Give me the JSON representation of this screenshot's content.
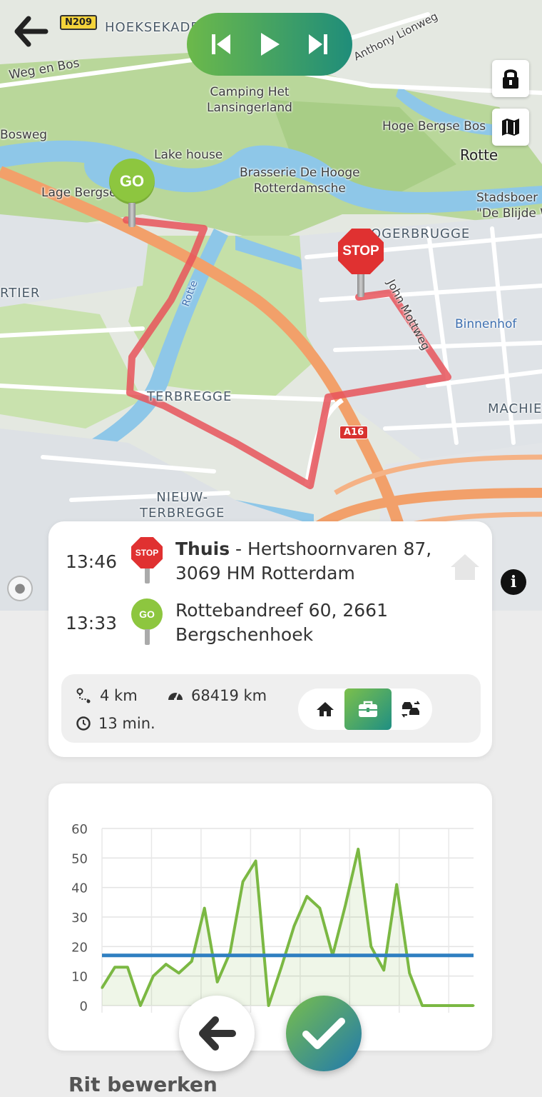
{
  "nav": {
    "back_icon": "arrow-left-icon",
    "player": {
      "prev_icon": "skip-previous-icon",
      "play_icon": "play-icon",
      "next_icon": "skip-next-icon"
    },
    "side_buttons": [
      "lock-icon",
      "map-icon"
    ],
    "info_icon": "info-icon"
  },
  "map": {
    "labels": {
      "hoeksekade": "HOEKSEKADE",
      "weg_en_bos": "Weg en Bos",
      "anthony": "Anthony Lionweg",
      "camping": "Camping Het\nLansingerland",
      "bosweg": "Bosweg",
      "lake_house": "Lake house",
      "hoge_bergse_bos": "Hoge Bergse Bos",
      "rotte": "Rotte",
      "brasserie": "Brasserie De Hooge\nRotterdamsche",
      "lage_bergse": "Lage Bergse",
      "stadsboerderij": "Stadsboer\n\"De Blijde W",
      "ogerbrugge": "OGERBRUGGE",
      "rtier": "RTIER",
      "rotte_river": "Rotte",
      "john_mottweg": "John Mottweg",
      "binnenhof": "Binnenhof",
      "terbregge": "TERBREGGE",
      "machie": "MACHIE",
      "nieuw_terbregge": "NIEUW-\nTERBREGGE"
    },
    "road_shields": {
      "n209": "N209",
      "a16": "A16"
    },
    "pins": {
      "go": "GO",
      "stop": "STOP"
    }
  },
  "trip": {
    "stops": [
      {
        "time": "13:46",
        "pin": "STOP",
        "name": "Thuis",
        "address_line1": " - Hertshoornvaren 87,",
        "address_line2": "3069 HM Rotterdam",
        "home_icon": "home-icon"
      },
      {
        "time": "13:33",
        "pin": "GO",
        "address_line1": "Rottebandreef 60, 2661",
        "address_line2": "Bergschenhoek"
      }
    ],
    "distance": "4 km",
    "odometer": "68419 km",
    "duration": "13 min.",
    "categories": [
      {
        "icon": "home-icon",
        "active": false
      },
      {
        "icon": "briefcase-icon",
        "active": true
      },
      {
        "icon": "car-swap-icon",
        "active": false
      }
    ],
    "colors": {
      "accent_green": "#8dc63f",
      "stop_red": "#e03131",
      "route": "#e8545a"
    }
  },
  "chart_data": {
    "type": "line",
    "x": [
      0,
      1,
      2,
      3,
      4,
      5,
      6,
      7,
      8,
      9,
      10,
      11,
      12,
      13,
      14,
      15,
      16,
      17,
      18,
      19,
      20,
      21,
      22,
      23,
      24,
      25,
      26,
      27,
      28,
      29
    ],
    "series": [
      {
        "values": [
          6,
          13,
          13,
          0,
          10,
          14,
          11,
          15,
          33,
          8,
          18,
          42,
          49,
          0,
          13,
          27,
          37,
          33,
          17,
          34,
          53,
          20,
          12,
          41,
          11,
          0,
          0,
          0,
          0,
          0
        ],
        "color": "#7bb843"
      },
      {
        "values": [
          17,
          17,
          17,
          17,
          17,
          17,
          17,
          17,
          17,
          17,
          17,
          17,
          17,
          17,
          17,
          17,
          17,
          17,
          17,
          17,
          17,
          17,
          17,
          17,
          17,
          17,
          17,
          17,
          17,
          17
        ],
        "color": "#2f7fc1"
      }
    ],
    "yticks": [
      0,
      10,
      20,
      30,
      40,
      50,
      60
    ],
    "ylim": [
      0,
      60
    ],
    "grid": true
  },
  "footer": {
    "back_icon": "arrow-left-icon",
    "confirm_icon": "checkmark-icon",
    "heading": "Rit bewerken"
  }
}
